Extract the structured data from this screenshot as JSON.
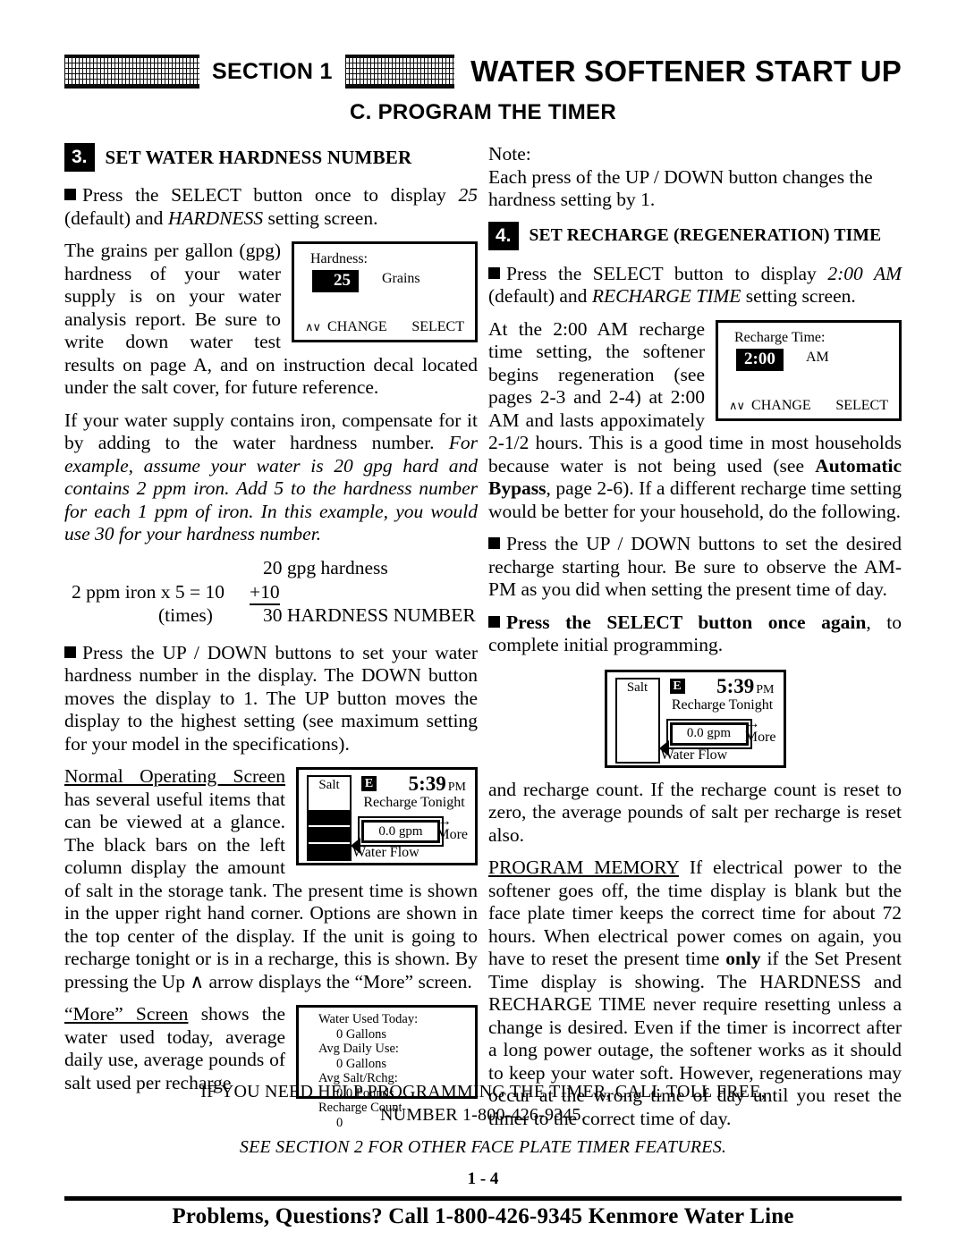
{
  "header": {
    "section_label": "SECTION 1",
    "title": "WATER SOFTENER START UP",
    "subtitle": "C.  PROGRAM THE TIMER"
  },
  "left_column": {
    "step3": {
      "number": "3.",
      "title": "SET WATER HARDNESS NUMBER"
    },
    "p_select": {
      "pre": "Press the SELECT button once to display ",
      "em1": "25",
      "mid": " (default) and ",
      "em2": "HARDNESS",
      "post": " setting screen."
    },
    "p_gpg": "The grains per gallon (gpg) hardness of your water supply is on your water analysis report. Be sure to write down water test results on page A, and on instruction decal located under the salt cover, for future reference.",
    "hardness_screen": {
      "label": "Hardness:",
      "value": "25",
      "unit": "Grains",
      "arrows": "∧∨",
      "change": "CHANGE",
      "select": "SELECT"
    },
    "p_iron": {
      "roman": "If your water supply contains iron, compensate for it by adding to the water hardness number. ",
      "italic": "For example, assume your water is 20 gpg hard and contains 2 ppm iron. Add 5 to the hardness number for each 1 ppm of iron. In this example, you would use 30 for your hardness number."
    },
    "math": {
      "gpg_line": "20 gpg hardness",
      "iron_line": "2 ppm iron x 5 = 10",
      "plus_line": "+10",
      "times_line": "(times)",
      "result_line": "30 HARDNESS NUMBER"
    },
    "p_updown": "Press the UP / DOWN buttons to set your water hardness number in the display. The DOWN button moves the display to 1. The UP button moves the display to the highest setting (see maximum setting for your model in the specifications).",
    "p_normal": {
      "underlined": "Normal Operating Screen",
      "rest": " has several useful items that can be viewed at a glance. The black bars on the left column display the amount of salt in the storage tank.  The present time is shown in the upper right hand corner.  Options are shown in the top center of the display.  If the unit is going to recharge tonight or is in a recharge, this is shown.  By pressing the Up ∧ arrow displays the “More” screen."
    },
    "p_more": {
      "underlined": "“More” Screen",
      "rest": " shows the water used today, average daily use, average pounds of salt used per recharge"
    },
    "lcd_screen": {
      "salt_label": "Salt",
      "salt_bars_filled": 3,
      "status_badge": "E",
      "time": "5:39",
      "ampm": "PM",
      "recharge_msg": "Recharge Tonight",
      "flow": "0.0 gpm",
      "arrow": "→",
      "more": "More",
      "water_flow": "Water Flow"
    },
    "more_screen": {
      "l1": "Water Used Today:",
      "v1": "0 Gallons",
      "l2": "Avg Daily Use:",
      "v2": "0 Gallons",
      "l3": "Avg Salt/Rchg:",
      "v3": "0.0 Pounds",
      "l4": "Recharge Count",
      "v4": "0"
    }
  },
  "right_column": {
    "p_note": "Note:\nEach press of the UP / DOWN button changes the hardness setting by 1.",
    "step4": {
      "number": "4.",
      "title": "SET RECHARGE (REGENERATION) TIME"
    },
    "p_select": {
      "pre": "Press the SELECT button to display ",
      "em1": "2:00 AM",
      "mid": " (default) and ",
      "em2": "RECHARGE TIME",
      "post": " setting screen."
    },
    "recharge_screen": {
      "label": "Recharge Time:",
      "value": "2:00",
      "unit": "AM",
      "arrows": "∧∨",
      "change": "CHANGE",
      "select": "SELECT"
    },
    "p_at200": {
      "pre": "At the 2:00 AM recharge time setting, the softener begins regeneration (see pages 2-3 and 2-4) at 2:00 AM and lasts appoximately 2-1/2 hours. This is a good time in most households because water is not being used (see ",
      "bold": "Automatic Bypass",
      "post": ", page 2-6). If a different recharge time setting would be better for your household, do the following."
    },
    "p_updown": "Press the UP / DOWN buttons to set the desired recharge starting hour. Be sure to observe the AM-PM as you did when setting the present time of day.",
    "p_select_again": {
      "bold": "Press the SELECT button once again",
      "rest": ", to complete initial programming."
    },
    "lcd_screen": {
      "salt_label": "Salt",
      "salt_bars_filled": 0,
      "status_badge": "E",
      "time": "5:39",
      "ampm": "PM",
      "recharge_msg": "Recharge Tonight",
      "flow": "0.0 gpm",
      "arrow": "→",
      "more": "More",
      "water_flow": "Water Flow"
    },
    "p_count": "and recharge count.  If the recharge count is reset to zero, the average pounds of salt per recharge is reset also.",
    "p_memory": {
      "underlined": "PROGRAM MEMORY",
      "pre": " If electrical power to the softener goes off, the time display is blank but the face plate timer keeps the correct time for about 72 hours. When electrical power comes on again, you have to reset the present time ",
      "bold": "only",
      "post": " if the Set Present Time display is showing.  The HARDNESS and RECHARGE TIME never require resetting unless a change is desired.  Even if the timer is incorrect after a long power outage, the softener works as it should to keep your water soft.  However, regenerations may occur at the wrong time of day until you reset the timer to the correct time of day."
    }
  },
  "footer": {
    "call_line1": "IF YOU NEED HELP PROGRAMMING THE TIMER, CALL TOLL FREE,",
    "call_line2": "NUMBER 1-800-426-9345.",
    "see_section": "SEE SECTION 2 FOR OTHER FACE PLATE TIMER FEATURES.",
    "page_number": "1 - 4",
    "bottom_bar": "Problems, Questions? Call 1-800-426-9345 Kenmore Water Line"
  }
}
